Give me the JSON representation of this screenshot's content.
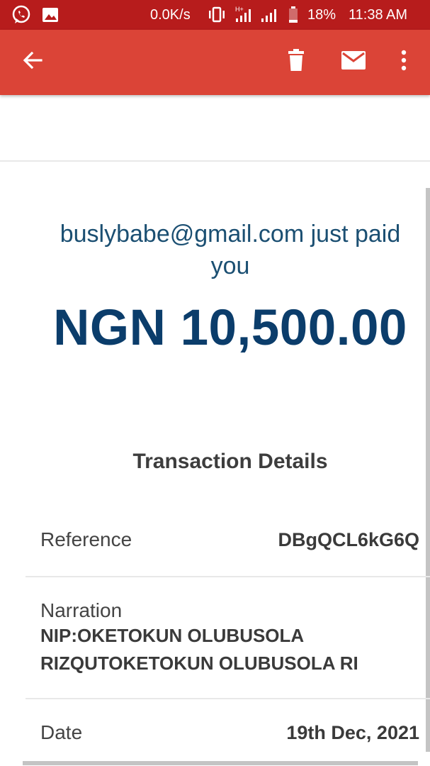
{
  "status_bar": {
    "net_speed": "0.0K/s",
    "battery_percent": "18%",
    "time": "11:38 AM",
    "icons": [
      "whatsapp-icon",
      "gallery-icon",
      "vibrate-icon",
      "hplus-signal-icon",
      "signal-icon",
      "battery-icon"
    ]
  },
  "app_bar": {
    "icons": [
      "back-arrow-icon",
      "delete-icon",
      "mail-icon",
      "more-vert-icon"
    ]
  },
  "email": {
    "paid_line1": "buslybabe@gmail.com just paid",
    "paid_line2": "you",
    "amount": "NGN 10,500.00",
    "details_title": "Transaction Details",
    "reference_label": "Reference",
    "reference_value": "DBgQCL6kG6Q",
    "narration_label": "Narration",
    "narration_line1": "NIP:OKETOKUN OLUBUSOLA",
    "narration_line2": "RIZQUTOKETOKUN OLUBUSOLA RI",
    "date_label": "Date",
    "date_value": "19th Dec, 2021"
  },
  "colors": {
    "status_bar": "#b71c1c",
    "app_bar": "#db4437",
    "amount": "#0b3d6b",
    "paid_text": "#1b4f72"
  }
}
